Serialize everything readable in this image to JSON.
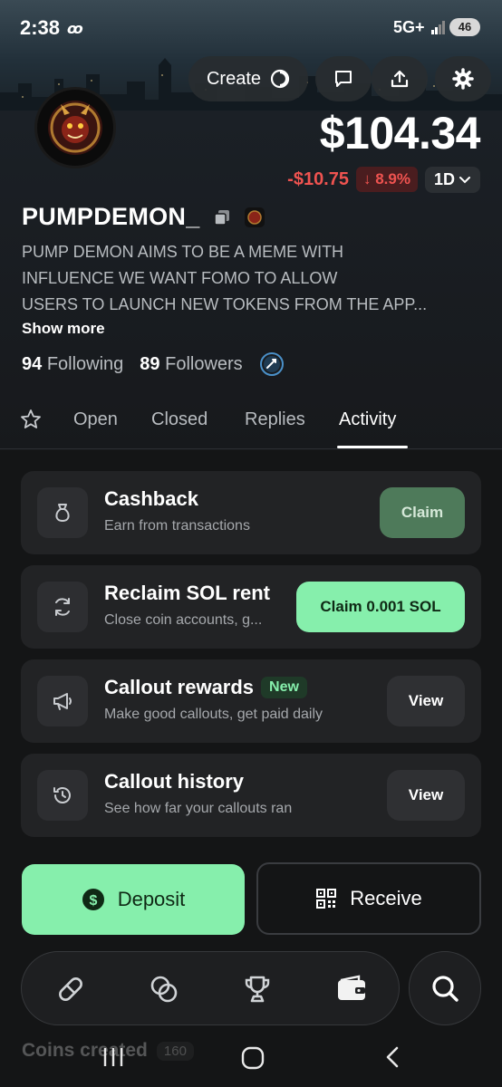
{
  "status_bar": {
    "time": "2:38",
    "app_icon_text": "ꝏ",
    "network": "5G+",
    "battery": "46"
  },
  "header": {
    "create_label": "Create",
    "balance": "$104.34",
    "change_amount": "-$10.75",
    "change_percent": "↓ 8.9%",
    "range": "1D"
  },
  "profile": {
    "username": "PUMPDEMON_",
    "bio": "PUMP DEMON AIMS TO BE A MEME WITH\nINFLUENCE WE WANT FOMO TO ALLOW\nUSERS TO LAUNCH NEW TOKENS FROM THE APP...",
    "show_more": "Show more",
    "following_count": "94",
    "following_label": "Following",
    "followers_count": "89",
    "followers_label": "Followers"
  },
  "tabs": [
    {
      "label": "Open"
    },
    {
      "label": "Closed"
    },
    {
      "label": "Replies"
    },
    {
      "label": "Activity",
      "active": true
    }
  ],
  "cards": [
    {
      "title": "Cashback",
      "subtitle": "Earn from transactions",
      "button": "Claim",
      "icon": "money-bag-icon"
    },
    {
      "title": "Reclaim SOL rent",
      "subtitle": "Close coin accounts, g...",
      "button": "Claim 0.001 SOL",
      "icon": "refresh-icon"
    },
    {
      "title": "Callout rewards",
      "badge": "New",
      "subtitle": "Make good callouts, get paid daily",
      "button": "View",
      "icon": "megaphone-icon"
    },
    {
      "title": "Callout history",
      "subtitle": "See how far your callouts ran",
      "button": "View",
      "icon": "history-icon"
    }
  ],
  "actions": {
    "deposit": "Deposit",
    "receive": "Receive"
  },
  "peek": {
    "title": "Coins created",
    "count": "160"
  },
  "colors": {
    "accent_green": "#86efac",
    "negative_red": "#ef5350",
    "card_bg": "#222325",
    "page_bg": "#141516"
  }
}
